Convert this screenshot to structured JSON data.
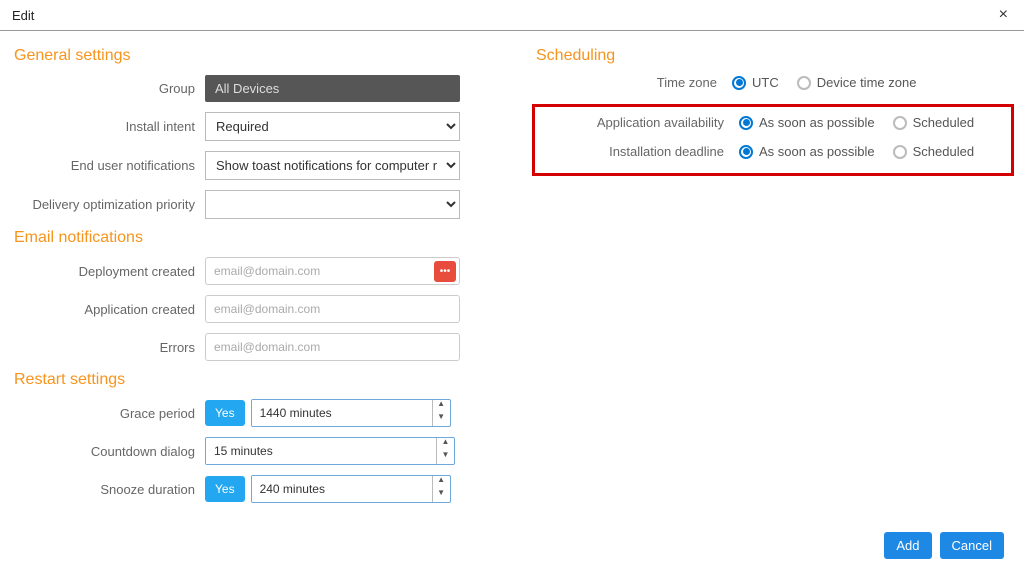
{
  "header": {
    "title": "Edit",
    "close": "×"
  },
  "sections": {
    "general": "General settings",
    "email": "Email notifications",
    "restart": "Restart settings",
    "scheduling": "Scheduling"
  },
  "general": {
    "group_label": "Group",
    "group_value": "All Devices",
    "install_intent_label": "Install intent",
    "install_intent_value": "Required",
    "end_user_label": "End user notifications",
    "end_user_value": "Show toast notifications for computer re…",
    "delivery_priority_label": "Delivery optimization priority",
    "delivery_priority_value": ""
  },
  "email": {
    "deployment_label": "Deployment created",
    "application_label": "Application created",
    "errors_label": "Errors",
    "placeholder": "email@domain.com"
  },
  "restart": {
    "grace_label": "Grace period",
    "grace_value": "1440 minutes",
    "countdown_label": "Countdown dialog",
    "countdown_value": "15 minutes",
    "snooze_label": "Snooze duration",
    "snooze_value": "240 minutes",
    "yes": "Yes"
  },
  "scheduling": {
    "timezone_label": "Time zone",
    "timezone_options": {
      "utc": "UTC",
      "device": "Device time zone"
    },
    "app_avail_label": "Application availability",
    "install_deadline_label": "Installation deadline",
    "asap": "As soon as possible",
    "scheduled": "Scheduled"
  },
  "footer": {
    "add": "Add",
    "cancel": "Cancel"
  }
}
